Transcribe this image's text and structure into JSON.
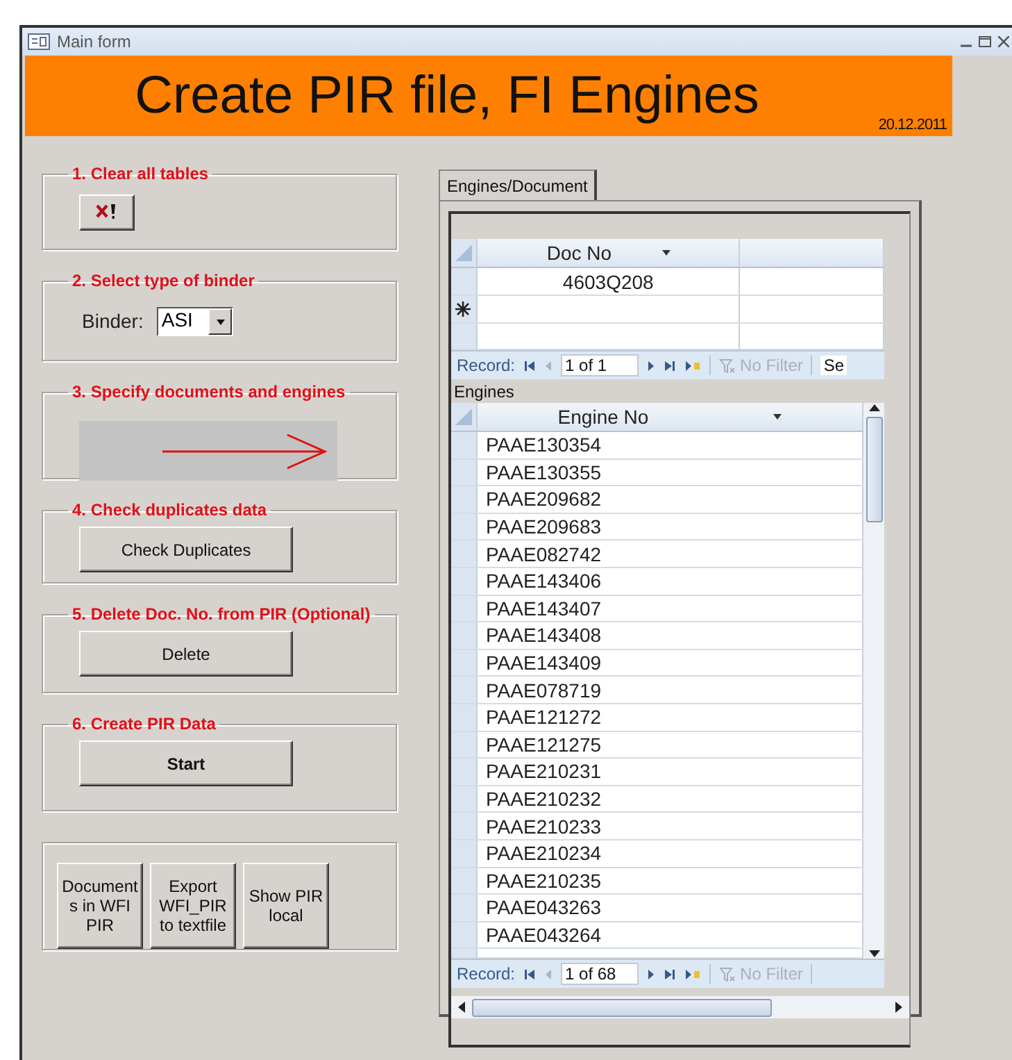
{
  "window": {
    "title": "Main form"
  },
  "header": {
    "title": "Create PIR file, FI Engines",
    "date": "20.12.2011"
  },
  "steps": [
    {
      "kind": "icon_button",
      "legend": "1. Clear all tables"
    },
    {
      "kind": "select",
      "legend": "2. Select type of binder",
      "label": "Binder:",
      "value": "ASI"
    },
    {
      "kind": "arrow",
      "legend": "3. Specify documents and engines"
    },
    {
      "kind": "button",
      "legend": "4. Check duplicates data",
      "button": "Check Duplicates",
      "bold": false
    },
    {
      "kind": "button",
      "legend": "5. Delete Doc. No. from PIR (Optional)",
      "button": "Delete",
      "bold": false
    },
    {
      "kind": "button",
      "legend": "6. Create PIR Data",
      "button": "Start",
      "bold": true
    }
  ],
  "extra_buttons": [
    {
      "lines": [
        "Document",
        "s in WFI",
        "PIR"
      ]
    },
    {
      "lines": [
        "Export",
        "WFI_PIR",
        "to textfile"
      ]
    },
    {
      "lines": [
        "Show PIR",
        "local"
      ]
    }
  ],
  "tabs": [
    {
      "label": "Engines/Document",
      "selected": true
    }
  ],
  "documents": {
    "column": "Doc No",
    "rows": [
      "4603Q208"
    ],
    "record_label": "Record:",
    "record": "1 of 1",
    "filter": "No Filter",
    "search": "Se"
  },
  "engines": {
    "label": "Engines",
    "column": "Engine No",
    "record_label": "Record:",
    "record": "1 of 68",
    "filter": "No Filter",
    "rows": [
      "PAAE130354",
      "PAAE130355",
      "PAAE209682",
      "PAAE209683",
      "PAAE082742",
      "PAAE143406",
      "PAAE143407",
      "PAAE143408",
      "PAAE143409",
      "PAAE078719",
      "PAAE121272",
      "PAAE121275",
      "PAAE210231",
      "PAAE210232",
      "PAAE210233",
      "PAAE210234",
      "PAAE210235",
      "PAAE043263",
      "PAAE043264"
    ]
  }
}
